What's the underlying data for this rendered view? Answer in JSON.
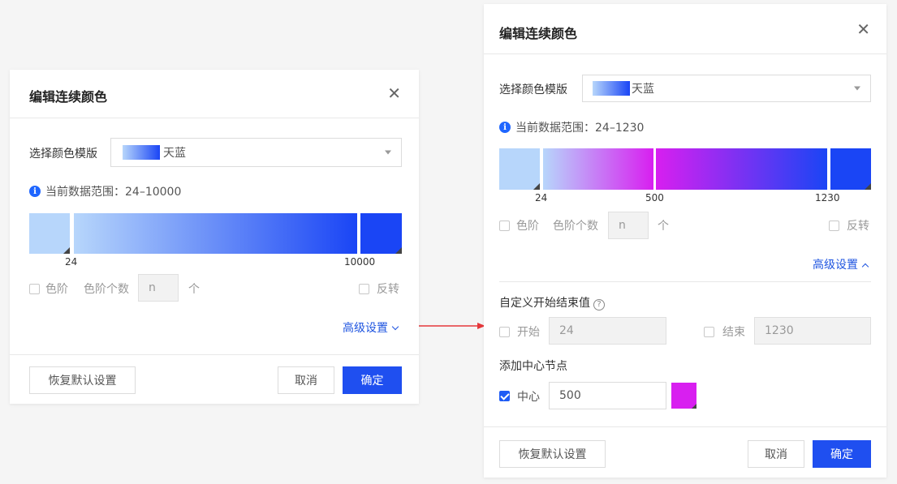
{
  "left": {
    "title": "编辑连续颜色",
    "template_label": "选择颜色模版",
    "template_value": "天蓝",
    "range_info": "当前数据范围：24–10000",
    "tick_start": "24",
    "tick_end": "10000",
    "step_label": "色阶",
    "step_count_label": "色阶个数",
    "step_count_placeholder": "n",
    "step_unit": "个",
    "reverse_label": "反转",
    "advanced_label": "高级设置",
    "reset_button": "恢复默认设置",
    "cancel_button": "取消",
    "ok_button": "确定"
  },
  "right": {
    "title": "编辑连续颜色",
    "template_label": "选择颜色模版",
    "template_value": "天蓝",
    "range_info": "当前数据范围：24–1230",
    "tick_start": "24",
    "tick_mid": "500",
    "tick_end": "1230",
    "step_label": "色阶",
    "step_count_label": "色阶个数",
    "step_count_placeholder": "n",
    "step_unit": "个",
    "reverse_label": "反转",
    "advanced_label": "高级设置",
    "custom_range_title": "自定义开始结束值",
    "start_label": "开始",
    "start_value": "24",
    "end_label": "结束",
    "end_value": "1230",
    "center_title": "添加中心节点",
    "center_label": "中心",
    "center_value": "500",
    "center_color": "#d81ff0",
    "reset_button": "恢复默认设置",
    "cancel_button": "取消",
    "ok_button": "确定"
  },
  "colors": {
    "start_color": "#b7d6fb",
    "end_color": "#1a45f5",
    "center_color": "#d81ff0",
    "accent": "#1f4ff0",
    "arrow": "#e5383b"
  }
}
